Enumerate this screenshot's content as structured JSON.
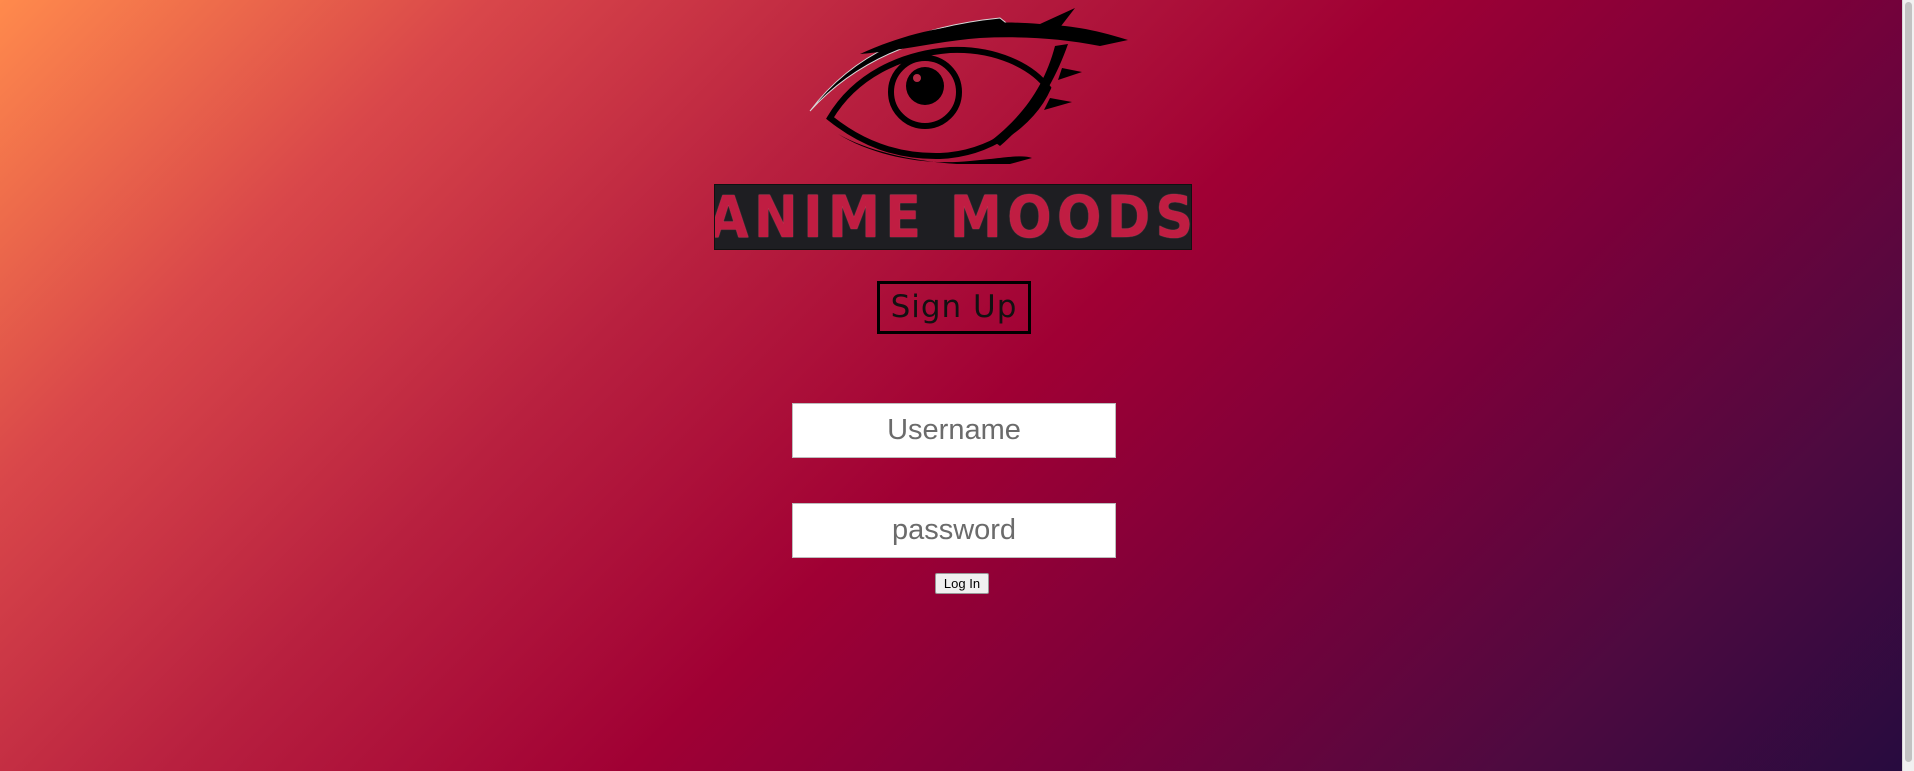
{
  "logo": {
    "brand_text": "ANIME MOODS",
    "icon": "eye-icon",
    "color_banner": "#1e1e22",
    "color_text": "#c01d42"
  },
  "signup": {
    "label": "Sign Up"
  },
  "login_form": {
    "username_placeholder": "Username",
    "password_placeholder": "password",
    "login_label": "Log In"
  },
  "colors": {
    "gradient_start": "#ff8a4c",
    "gradient_mid": "#a00034",
    "gradient_end": "#260b3f"
  }
}
